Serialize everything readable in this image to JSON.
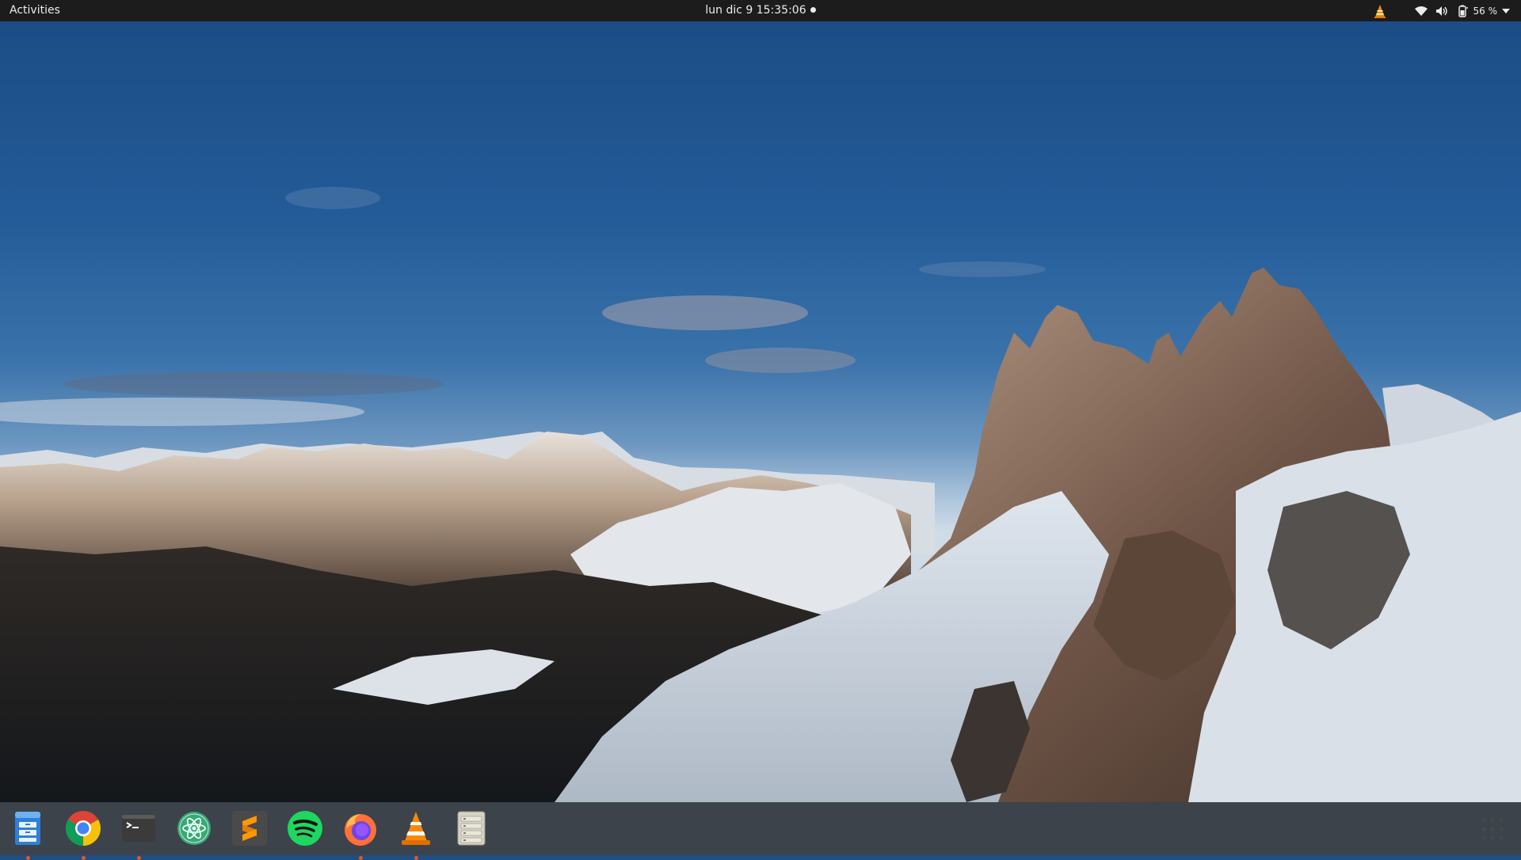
{
  "topbar": {
    "activities_label": "Activities",
    "date": "lun dic 9",
    "time": "15:35:06",
    "battery_percent": "56 %"
  },
  "tray_icons": [
    "vlc-tray-icon",
    "wifi-icon",
    "volume-icon",
    "battery-icon",
    "chevron-down-icon"
  ],
  "dock": {
    "apps": [
      {
        "name": "Files",
        "icon": "files-icon",
        "running": true
      },
      {
        "name": "Google Chrome",
        "icon": "chrome-icon",
        "running": true
      },
      {
        "name": "Terminal",
        "icon": "terminal-icon",
        "running": true
      },
      {
        "name": "Atom",
        "icon": "atom-icon",
        "running": false
      },
      {
        "name": "Sublime Text",
        "icon": "sublime-icon",
        "running": false
      },
      {
        "name": "Spotify",
        "icon": "spotify-icon",
        "running": false
      },
      {
        "name": "Firefox",
        "icon": "firefox-icon",
        "running": true
      },
      {
        "name": "VLC",
        "icon": "vlc-icon",
        "running": true
      },
      {
        "name": "Archive Manager",
        "icon": "archive-icon",
        "running": false
      }
    ],
    "show_apps_icon": "apps-grid-icon"
  },
  "colors": {
    "topbar_bg": "#1c1c1c",
    "running_indicator": "#e95420",
    "sky": "#235b98"
  },
  "wallpaper": "mountain landscape"
}
